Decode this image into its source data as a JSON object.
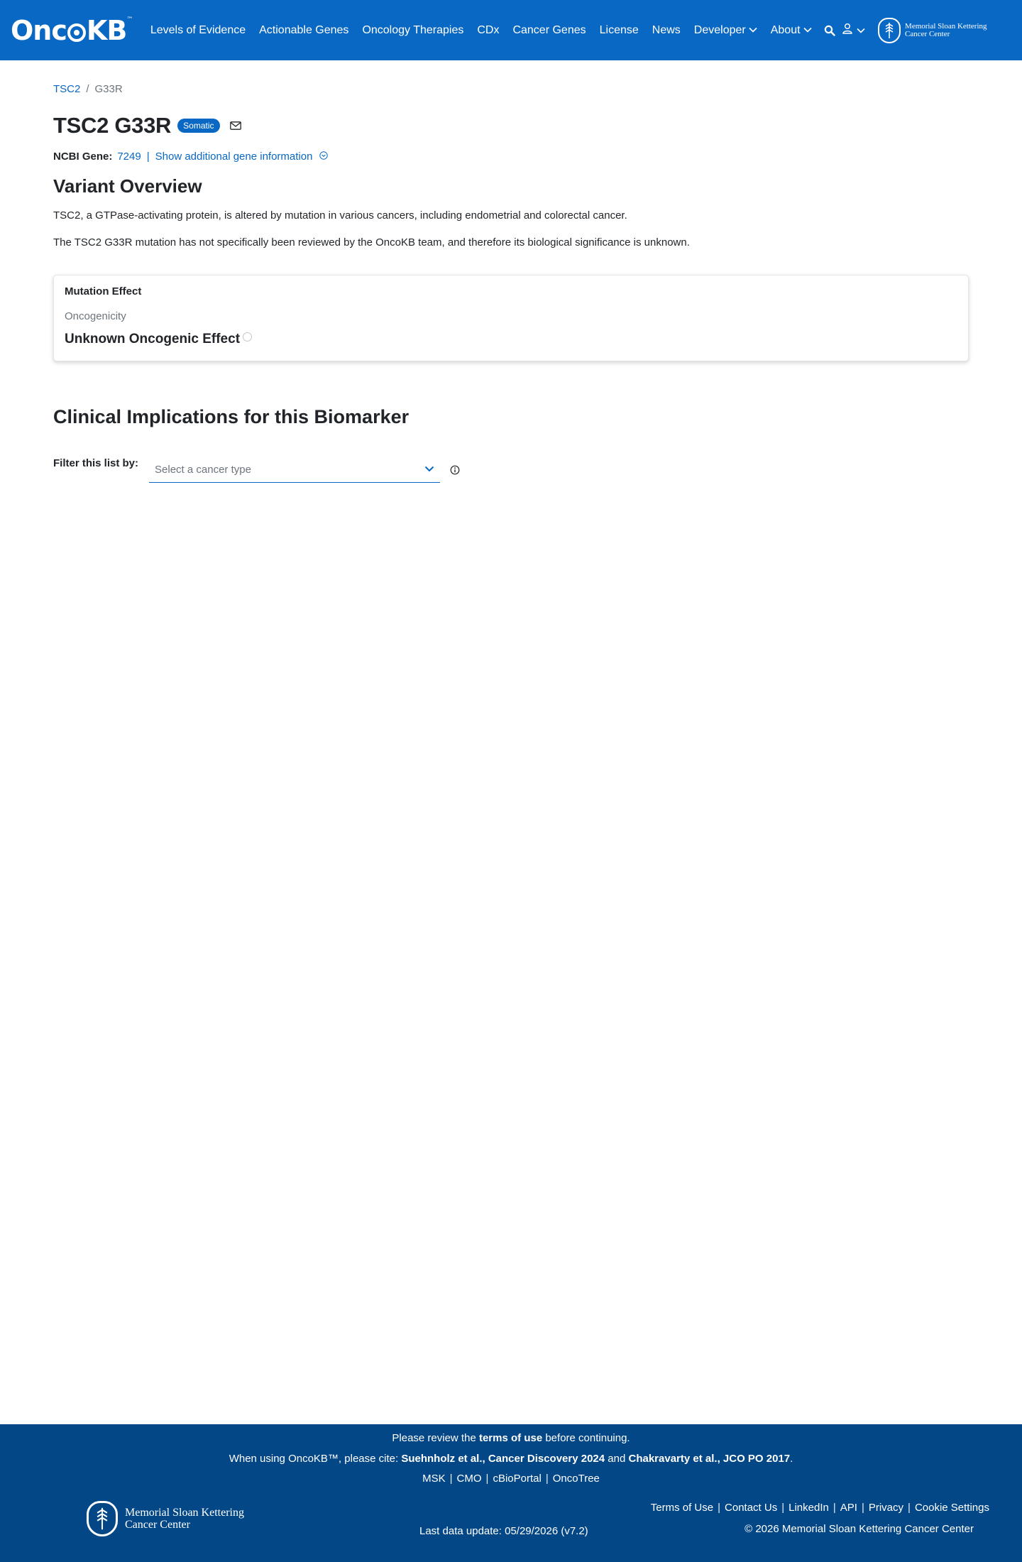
{
  "header": {
    "logo_text_left": "Onc",
    "logo_text_right": "KB",
    "logo_tm": "™",
    "nav": [
      {
        "label": "Levels of Evidence"
      },
      {
        "label": "Actionable Genes"
      },
      {
        "label": "Oncology Therapies"
      },
      {
        "label": "CDx"
      },
      {
        "label": "Cancer Genes"
      },
      {
        "label": "License"
      },
      {
        "label": "News"
      },
      {
        "label": "Developer"
      },
      {
        "label": "About"
      }
    ],
    "msk_line1": "Memorial Sloan Kettering",
    "msk_line2": "Cancer Center"
  },
  "breadcrumb": {
    "gene": "TSC2",
    "separator": "/",
    "variant": "G33R"
  },
  "page": {
    "title": "TSC2 G33R",
    "badge": "Somatic",
    "ncbi_label": "NCBI Gene:",
    "ncbi_id": "7249",
    "ncbi_separator": "|",
    "show_info": "Show additional gene information"
  },
  "overview": {
    "heading": "Variant Overview",
    "paragraph1": "TSC2, a GTPase-activating protein, is altered by mutation in various cancers, including endometrial and colorectal cancer.",
    "paragraph2": "The TSC2 G33R mutation has not specifically been reviewed by the OncoKB team, and therefore its biological significance is unknown."
  },
  "mutation_effect": {
    "title": "Mutation Effect",
    "subtitle": "Oncogenicity",
    "value": "Unknown Oncogenic Effect"
  },
  "clinical": {
    "heading": "Clinical Implications for this Biomarker",
    "filter_label": "Filter this list by:",
    "select_placeholder": "Select a cancer type"
  },
  "footer": {
    "review_prefix": "Please review the",
    "review_link": "terms of use",
    "review_suffix": "before continuing.",
    "cite_prefix": "When using OncoKB™, please cite:",
    "cite_ref1": "Suehnholz et al., Cancer Discovery 2024",
    "cite_and": "and",
    "cite_ref2": "Chakravarty et al., JCO PO 2017",
    "cite_end": ".",
    "links": [
      "MSK",
      "CMO",
      "cBioPortal",
      "OncoTree"
    ],
    "msk_line1": "Memorial Sloan Kettering",
    "msk_line2": "Cancer Center",
    "last_update": "Last data update: 05/29/2026 (v7.2)",
    "right_links": [
      "Terms of Use",
      "Contact Us",
      "LinkedIn",
      "API",
      "Privacy",
      "Cookie Settings"
    ],
    "copyright": "© 2026 Memorial Sloan Kettering Cancer Center"
  },
  "colors": {
    "header_bg": "#0968c3",
    "footer_bg": "#044786",
    "link": "#0968c3"
  }
}
